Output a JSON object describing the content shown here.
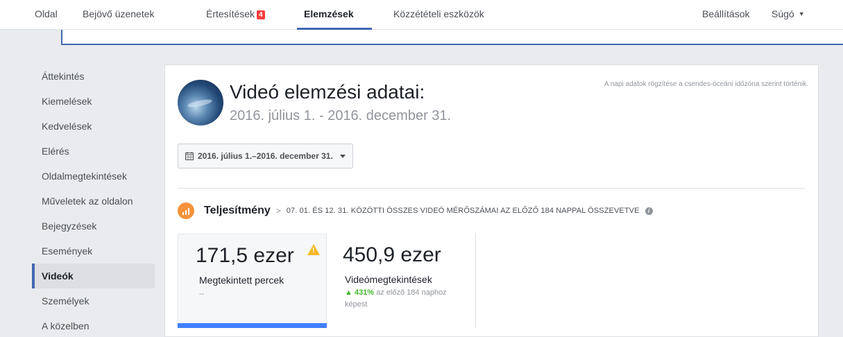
{
  "nav": {
    "items": [
      {
        "label": "Oldal"
      },
      {
        "label": "Bejövő üzenetek"
      },
      {
        "label": "Értesítések",
        "badge": "4"
      },
      {
        "label": "Elemzések"
      },
      {
        "label": "Közzétételi eszközök"
      },
      {
        "label": "Beállítások"
      },
      {
        "label": "Súgó"
      }
    ],
    "active_index": 3
  },
  "sidebar": {
    "items": [
      {
        "label": "Áttekintés"
      },
      {
        "label": "Kiemelések"
      },
      {
        "label": "Kedvelések"
      },
      {
        "label": "Elérés"
      },
      {
        "label": "Oldalmegtekintések"
      },
      {
        "label": "Műveletek az oldalon"
      },
      {
        "label": "Bejegyzések"
      },
      {
        "label": "Események"
      },
      {
        "label": "Videók"
      },
      {
        "label": "Személyek"
      },
      {
        "label": "A közelben"
      }
    ],
    "active_index": 8
  },
  "header": {
    "title": "Videó elemzési adatai:",
    "date_range": "2016. július 1. - 2016. december 31.",
    "timezone_note": "A napi adatok rögzítése a csendes-óceáni időzóna szerint történik."
  },
  "date_picker": {
    "label": "2016. július 1.–2016. december 31.",
    "icon": "calendar-icon"
  },
  "performance": {
    "title": "Teljesítmény",
    "description": "07. 01. ÉS 12. 31. KÖZÖTTI ÖSSZES VIDEÓ MÉRŐSZÁMAI AZ ELŐZŐ 184 NAPPAL ÖSSZEVETVE",
    "icon": "bar-chart-icon",
    "info_icon": "i"
  },
  "metrics": [
    {
      "value": "171,5 ezer",
      "label": "Megtekintett percek",
      "change": "--",
      "warning_icon": "!"
    },
    {
      "value": "450,9 ezer",
      "label": "Videómegtekintések",
      "change_pct": "431%",
      "change_text": "az előző 184 naphoz képest"
    }
  ],
  "colors": {
    "accent": "#4267b2",
    "badge": "#fa3e3e",
    "metric_bar": "#4080ff",
    "positive": "#42b72a",
    "perf_icon": "#f7923b",
    "warning": "#f7b928"
  }
}
